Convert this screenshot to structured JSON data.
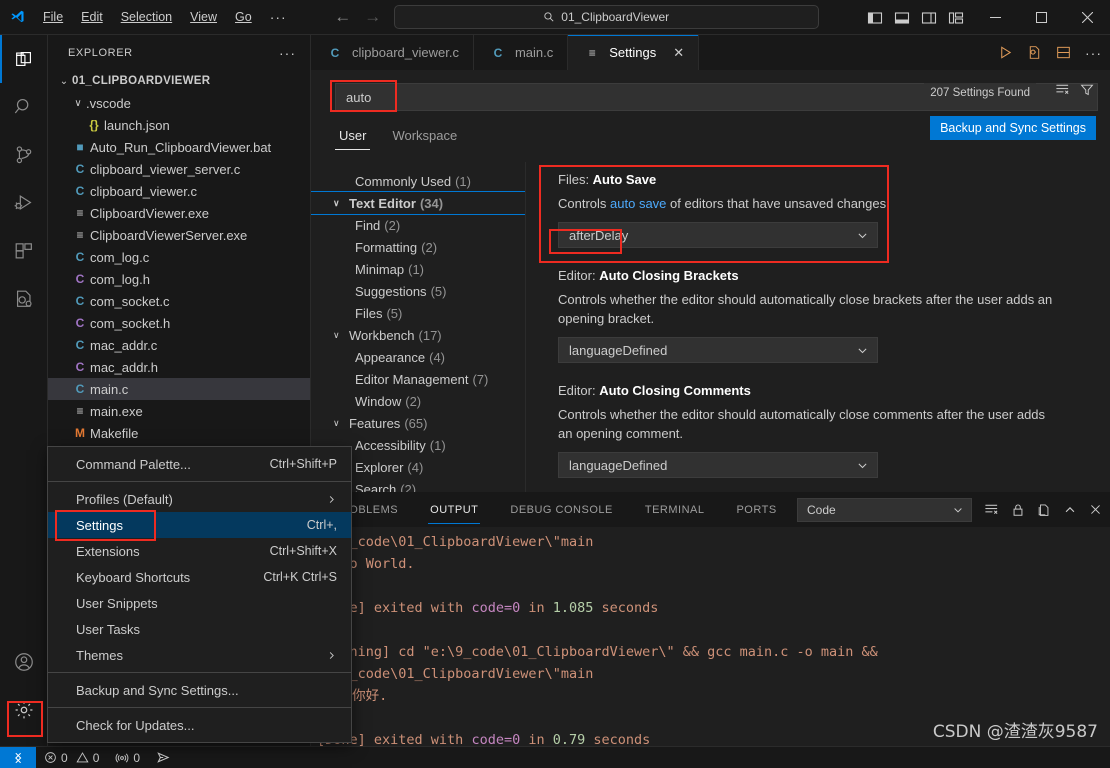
{
  "titlebar": {
    "logo_icon": "vscode-logo-icon",
    "menus": [
      "File",
      "Edit",
      "Selection",
      "View",
      "Go"
    ],
    "overflow_label": "···",
    "back_icon": "arrow-left-icon",
    "forward_icon": "arrow-right-icon",
    "command_center_text": "01_ClipboardViewer",
    "command_center_icon": "search-icon",
    "layout_icons": [
      "toggle-primary-sidebar-icon",
      "toggle-panel-icon",
      "toggle-secondary-sidebar-icon",
      "customize-layout-icon"
    ],
    "minimize_label": "—",
    "maximize_label": "☐",
    "close_label": "✕"
  },
  "activitybar": {
    "items": [
      {
        "name": "explorer-icon",
        "active": true
      },
      {
        "name": "search-icon",
        "active": false
      },
      {
        "name": "source-control-icon",
        "active": false
      },
      {
        "name": "run-and-debug-icon",
        "active": false
      },
      {
        "name": "extensions-icon",
        "active": false
      },
      {
        "name": "cpp-tools-icon",
        "active": false
      }
    ],
    "account_icon": "account-icon",
    "settings_icon": "manage-gear-icon"
  },
  "sidebar": {
    "title": "EXPLORER",
    "more_actions": "···",
    "root": "01_CLIPBOARDVIEWER",
    "tree": [
      {
        "label": ".vscode",
        "indent": 1,
        "kind": "folder",
        "icon": "folder-icon",
        "expanded": true
      },
      {
        "label": "launch.json",
        "indent": 2,
        "kind": "json",
        "icon": "{}",
        "color": "#cbcb41"
      },
      {
        "label": "Auto_Run_ClipboardViewer.bat",
        "indent": 1,
        "kind": "bat",
        "icon": "■",
        "color": "#519aba"
      },
      {
        "label": "clipboard_viewer_server.c",
        "indent": 1,
        "kind": "c",
        "icon": "C",
        "color": "#519aba"
      },
      {
        "label": "clipboard_viewer.c",
        "indent": 1,
        "kind": "c",
        "icon": "C",
        "color": "#519aba"
      },
      {
        "label": "ClipboardViewer.exe",
        "indent": 1,
        "kind": "exe",
        "icon": "≡",
        "color": "#cccccc"
      },
      {
        "label": "ClipboardViewerServer.exe",
        "indent": 1,
        "kind": "exe",
        "icon": "≡",
        "color": "#cccccc"
      },
      {
        "label": "com_log.c",
        "indent": 1,
        "kind": "c",
        "icon": "C",
        "color": "#519aba"
      },
      {
        "label": "com_log.h",
        "indent": 1,
        "kind": "h",
        "icon": "C",
        "color": "#a074c4"
      },
      {
        "label": "com_socket.c",
        "indent": 1,
        "kind": "c",
        "icon": "C",
        "color": "#519aba"
      },
      {
        "label": "com_socket.h",
        "indent": 1,
        "kind": "h",
        "icon": "C",
        "color": "#a074c4"
      },
      {
        "label": "mac_addr.c",
        "indent": 1,
        "kind": "c",
        "icon": "C",
        "color": "#519aba"
      },
      {
        "label": "mac_addr.h",
        "indent": 1,
        "kind": "h",
        "icon": "C",
        "color": "#a074c4"
      },
      {
        "label": "main.c",
        "indent": 1,
        "kind": "c",
        "icon": "C",
        "color": "#519aba",
        "selected": true
      },
      {
        "label": "main.exe",
        "indent": 1,
        "kind": "exe",
        "icon": "≡",
        "color": "#cccccc"
      },
      {
        "label": "Makefile",
        "indent": 1,
        "kind": "makefile",
        "icon": "M",
        "color": "#e37933"
      }
    ]
  },
  "editor": {
    "tabs": [
      {
        "label": "clipboard_viewer.c",
        "icon": "C",
        "icon_color": "#519aba",
        "active": false,
        "closable": false
      },
      {
        "label": "main.c",
        "icon": "C",
        "icon_color": "#519aba",
        "active": false,
        "closable": false
      },
      {
        "label": "Settings",
        "icon": "≡",
        "icon_color": "#cccccc",
        "active": true,
        "closable": true,
        "close_label": "✕"
      }
    ],
    "actions": [
      "run-icon",
      "run-and-debug-file-icon",
      "split-editor-icon",
      "more-actions-icon"
    ]
  },
  "settings": {
    "search_value": "auto",
    "search_placeholder": "Search settings",
    "count_label": "207 Settings Found",
    "clear_filter_icon": "clear-settings-search-icon",
    "filter_icon": "filter-icon",
    "tabs": [
      {
        "label": "User",
        "active": true
      },
      {
        "label": "Workspace",
        "active": false
      }
    ],
    "backup_button": "Backup and Sync Settings",
    "toc": [
      {
        "label": "Commonly Used",
        "count": "(1)",
        "indent": 1,
        "chevron": "",
        "bold": false
      },
      {
        "label": "Text Editor",
        "count": "(34)",
        "indent": 0,
        "chevron": "∨",
        "bold": true,
        "focused": true
      },
      {
        "label": "Find",
        "count": "(2)",
        "indent": 1,
        "chevron": "",
        "bold": false
      },
      {
        "label": "Formatting",
        "count": "(2)",
        "indent": 1,
        "chevron": "",
        "bold": false
      },
      {
        "label": "Minimap",
        "count": "(1)",
        "indent": 1,
        "chevron": "",
        "bold": false
      },
      {
        "label": "Suggestions",
        "count": "(5)",
        "indent": 1,
        "chevron": "",
        "bold": false
      },
      {
        "label": "Files",
        "count": "(5)",
        "indent": 1,
        "chevron": "",
        "bold": false
      },
      {
        "label": "Workbench",
        "count": "(17)",
        "indent": 0,
        "chevron": "∨",
        "bold": false
      },
      {
        "label": "Appearance",
        "count": "(4)",
        "indent": 1,
        "chevron": "",
        "bold": false
      },
      {
        "label": "Editor Management",
        "count": "(7)",
        "indent": 1,
        "chevron": "",
        "bold": false
      },
      {
        "label": "Window",
        "count": "(2)",
        "indent": 1,
        "chevron": "",
        "bold": false
      },
      {
        "label": "Features",
        "count": "(65)",
        "indent": 0,
        "chevron": "∨",
        "bold": false
      },
      {
        "label": "Accessibility",
        "count": "(1)",
        "indent": 1,
        "chevron": "",
        "bold": false
      },
      {
        "label": "Explorer",
        "count": "(4)",
        "indent": 1,
        "chevron": "",
        "bold": false
      },
      {
        "label": "Search",
        "count": "(2)",
        "indent": 1,
        "chevron": "",
        "bold": false
      }
    ],
    "items": [
      {
        "prefix": "Files: ",
        "title": "Auto Save",
        "desc_before": "Controls ",
        "desc_link": "auto save",
        "desc_after": " of editors that have unsaved changes.",
        "value": "afterDelay",
        "chevron": "∨"
      },
      {
        "prefix": "Editor: ",
        "title": "Auto Closing Brackets",
        "desc_before": "Controls whether the editor should automatically close brackets after the user adds an opening bracket.",
        "desc_link": "",
        "desc_after": "",
        "value": "languageDefined",
        "chevron": "∨"
      },
      {
        "prefix": "Editor: ",
        "title": "Auto Closing Comments",
        "desc_before": "Controls whether the editor should automatically close comments after the user adds an opening comment.",
        "desc_link": "",
        "desc_after": "",
        "value": "languageDefined",
        "chevron": "∨"
      }
    ]
  },
  "panel": {
    "tabs": [
      {
        "label": "PROBLEMS",
        "active": false
      },
      {
        "label": "OUTPUT",
        "active": true
      },
      {
        "label": "DEBUG CONSOLE",
        "active": false
      },
      {
        "label": "TERMINAL",
        "active": false
      },
      {
        "label": "PORTS",
        "active": false
      }
    ],
    "channel_value": "Code",
    "channel_chevron": "∨",
    "actions": [
      "clear-output-icon",
      "lock-scroll-icon",
      "open-in-editor-icon",
      "hide-panel-icon",
      "close-panel-icon"
    ],
    "lines": [
      "e:\\9_code\\01_ClipboardViewer\\\"main",
      "Hello World.",
      "",
      "[Done] exited with code=0 in 1.085 seconds",
      "",
      "[Running] cd \"e:\\9_code\\01_ClipboardViewer\\\" && gcc main.c -o main &&",
      "e:\\9_code\\01_ClipboardViewer\\\"main",
      "世界 你好.",
      "",
      "[Done] exited with code=0 in 0.79 seconds"
    ]
  },
  "contextmenu": {
    "items": [
      {
        "label": "Command Palette...",
        "key": "Ctrl+Shift+P",
        "submenu": false,
        "active": false,
        "sep_after": true
      },
      {
        "label": "Profiles (Default)",
        "key": "",
        "submenu": true,
        "active": false,
        "sep_after": false
      },
      {
        "label": "Settings",
        "key": "Ctrl+,",
        "submenu": false,
        "active": true,
        "sep_after": false
      },
      {
        "label": "Extensions",
        "key": "Ctrl+Shift+X",
        "submenu": false,
        "active": false,
        "sep_after": false
      },
      {
        "label": "Keyboard Shortcuts",
        "key": "Ctrl+K Ctrl+S",
        "submenu": false,
        "active": false,
        "sep_after": false
      },
      {
        "label": "User Snippets",
        "key": "",
        "submenu": false,
        "active": false,
        "sep_after": false
      },
      {
        "label": "User Tasks",
        "key": "",
        "submenu": false,
        "active": false,
        "sep_after": false
      },
      {
        "label": "Themes",
        "key": "",
        "submenu": true,
        "active": false,
        "sep_after": true
      },
      {
        "label": "Backup and Sync Settings...",
        "key": "",
        "submenu": false,
        "active": false,
        "sep_after": true
      },
      {
        "label": "Check for Updates...",
        "key": "",
        "submenu": false,
        "active": false,
        "sep_after": false
      }
    ]
  },
  "statusbar": {
    "remote_icon": "remote-window-icon",
    "errors_icon": "error-icon",
    "errors": "0",
    "warnings_icon": "warning-icon",
    "warnings": "0",
    "ports_icon": "ports-icon",
    "ports": "0",
    "send_icon": "send-feedback-icon"
  },
  "watermark": "CSDN @渣渣灰9587",
  "colors": {
    "accent": "#0078d4",
    "annotation": "#ee2b21",
    "selection": "#37373d",
    "menu_active": "#04395e",
    "link": "#4daafc"
  }
}
